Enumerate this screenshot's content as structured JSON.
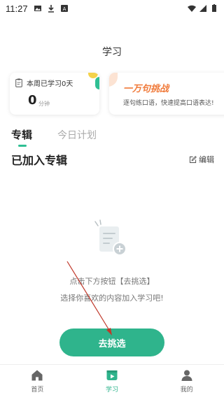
{
  "status_bar": {
    "time": "11:27"
  },
  "page": {
    "title": "学习"
  },
  "week_card": {
    "label": "本周已学习0天",
    "value": "0",
    "unit": "分钟"
  },
  "challenge_card": {
    "title": "一万句挑战",
    "subtitle": "逐句练口语，快速提高口语表达!"
  },
  "tabs": [
    {
      "label": "专辑",
      "active": true
    },
    {
      "label": "今日计划",
      "active": false
    }
  ],
  "section": {
    "title": "已加入专辑",
    "edit_label": "编辑"
  },
  "empty_state": {
    "line1": "点击下方按钮【去挑选】",
    "line2": "选择你喜欢的内容加入学习吧!",
    "button_label": "去挑选"
  },
  "bottom_nav": [
    {
      "label": "首页",
      "icon": "home-icon",
      "active": false
    },
    {
      "label": "学习",
      "icon": "study-icon",
      "active": true
    },
    {
      "label": "我的",
      "icon": "profile-icon",
      "active": false
    }
  ],
  "colors": {
    "accent": "#2fb48c",
    "challenge": "#f07a3a"
  }
}
